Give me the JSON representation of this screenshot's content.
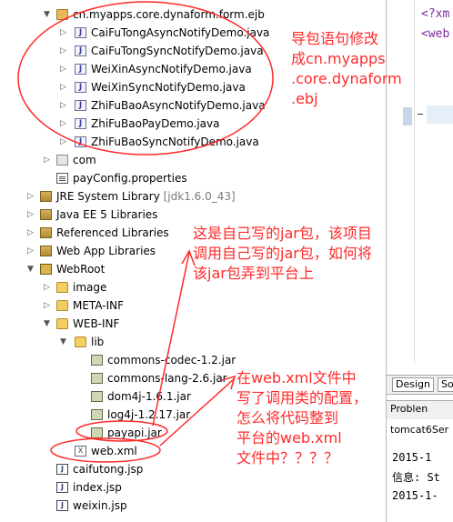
{
  "tree": {
    "package_main": "cn.myapps.core.dynaform.form.ejb",
    "java_files": [
      "CaiFuTongAsyncNotifyDemo.java",
      "CaiFuTongSyncNotifyDemo.java",
      "WeiXinAsyncNotifyDemo.java",
      "WeiXinSyncNotifyDemo.java",
      "ZhiFuBaoAsyncNotifyDemo.java",
      "ZhiFuBaoPayDemo.java",
      "ZhiFuBaoSyncNotifyDemo.java"
    ],
    "package_com": "com",
    "pay_config": "payConfig.properties",
    "jre_library": "JRE System Library",
    "jre_version": "[jdk1.6.0_43]",
    "javaee_library": "Java EE 5 Libraries",
    "referenced_libraries": "Referenced Libraries",
    "webapp_libraries": "Web App Libraries",
    "webroot": "WebRoot",
    "image_folder": "image",
    "metainf_folder": "META-INF",
    "webinf_folder": "WEB-INF",
    "lib_folder": "lib",
    "jars": [
      "commons-codec-1.2.jar",
      "commons-lang-2.6.jar",
      "dom4j-1.6.1.jar",
      "log4j-1.2.17.jar",
      "payapi.jar"
    ],
    "web_xml": "web.xml",
    "jsp_files": [
      "caifutong.jsp",
      "index.jsp",
      "weixin.jsp"
    ]
  },
  "editor": {
    "line1": "<?xm",
    "line2": "<web",
    "tab_design": "Design",
    "tab_source": "So",
    "problems_tab": "Problen",
    "server_label": "tomcat6Ser",
    "console_lines": [
      "2015-1",
      "信息: St",
      "2015-1-"
    ]
  },
  "annotations": {
    "note1": [
      "导包语句修改",
      "成cn.myapps",
      ".core.dynaform",
      ".ebj"
    ],
    "note2": [
      "这是自己写的jar包，该项目",
      "调用自己写的jar包，如何将",
      "该jar包弄到平台上"
    ],
    "note3": [
      "在web.xml文件中",
      "写了调用类的配置，",
      "怎么将代码整到",
      "平台的web.xml",
      "文件中？？？？"
    ],
    "color": "#ff2a2a"
  }
}
